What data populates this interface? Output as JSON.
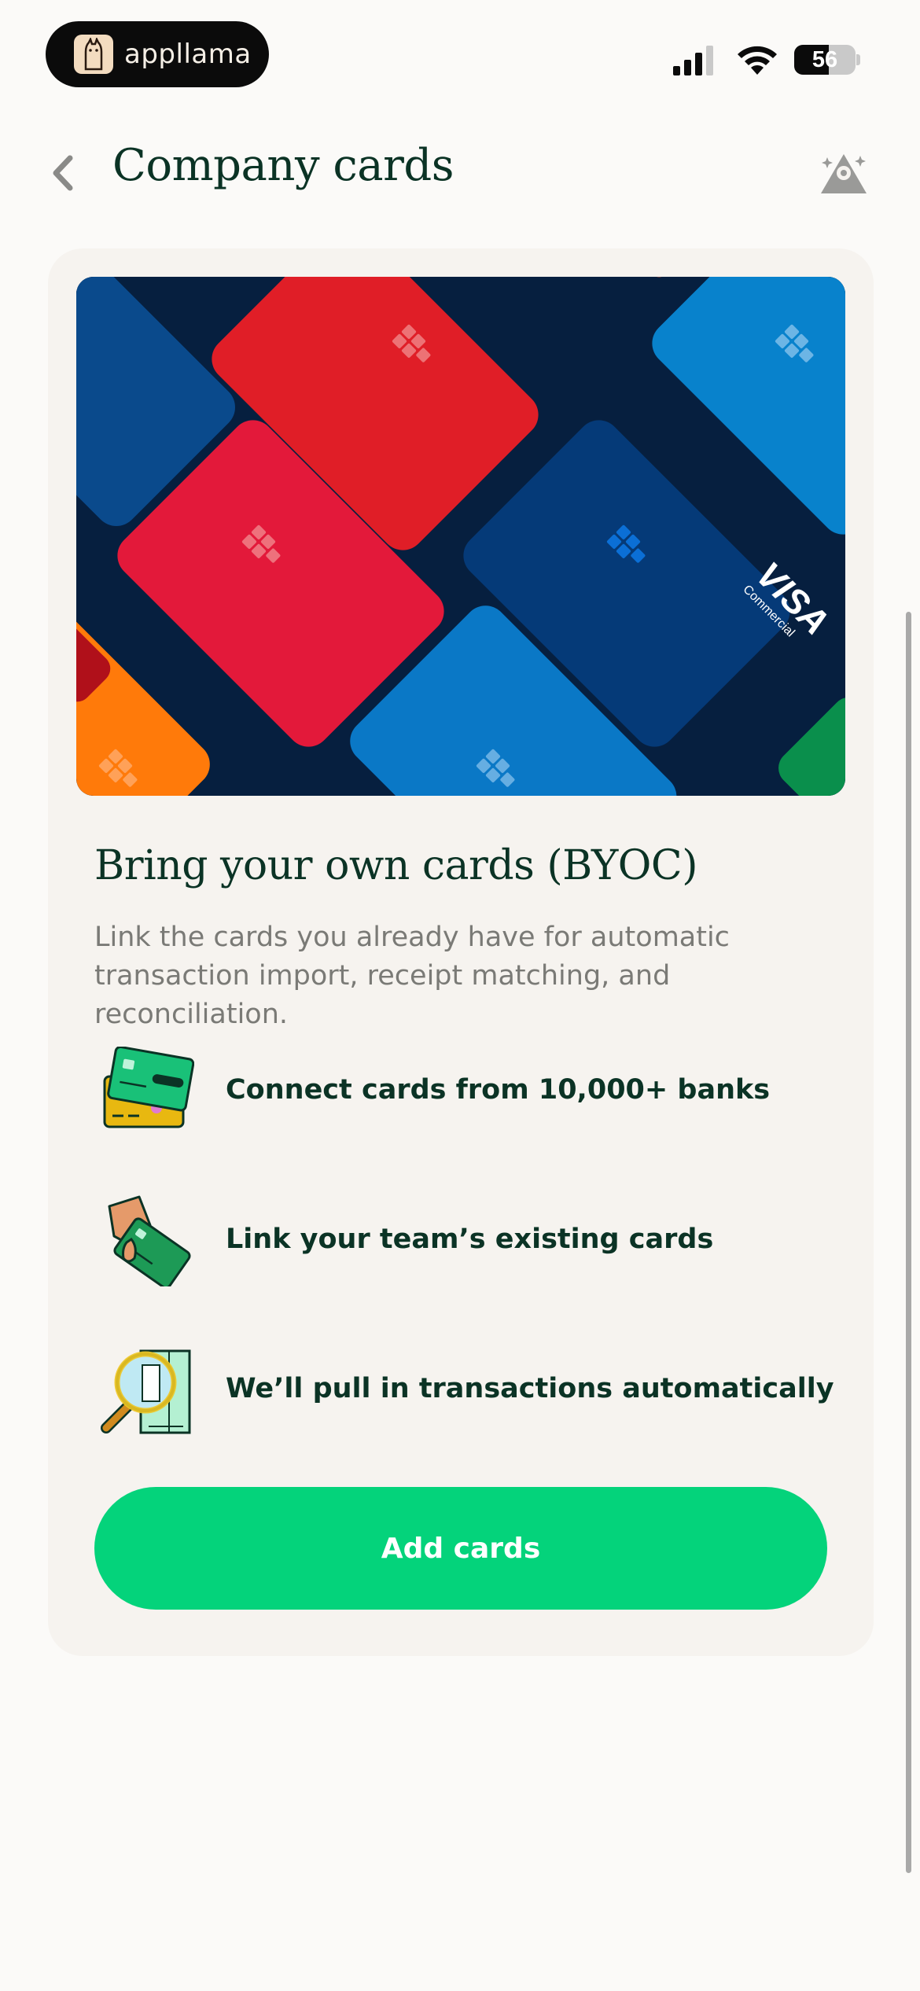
{
  "status_bar": {
    "app_name": "appllama",
    "battery_level": "56",
    "battery_fraction": 0.56,
    "icons": [
      "app-logo-icon",
      "cellular-signal-icon",
      "wifi-icon",
      "battery-icon"
    ]
  },
  "header": {
    "title": "Company cards",
    "back_icon": "chevron-left-icon",
    "assistant_icon": "sparkle-assistant-icon"
  },
  "hero": {
    "card_brand": "VISA",
    "card_brand_sub": "Commercial"
  },
  "byoc": {
    "title": "Bring your own cards (BYOC)",
    "description": "Link the cards you already have for automatic transaction import, receipt matching, and reconciliation."
  },
  "features": [
    {
      "icon": "bank-cards-icon",
      "label": "Connect cards from 10,000+ banks"
    },
    {
      "icon": "hand-card-icon",
      "label": "Link your team’s existing cards"
    },
    {
      "icon": "magnifier-receipt-icon",
      "label": "We’ll pull in transactions automatically"
    }
  ],
  "actions": {
    "add_cards_label": "Add cards"
  },
  "colors": {
    "background": "#fbfaf8",
    "panel": "#f6f3ef",
    "primary_text": "#0b3325",
    "secondary_text": "#7a7a76",
    "accent_green": "#04d37b",
    "hero_background": "#061f3f"
  }
}
